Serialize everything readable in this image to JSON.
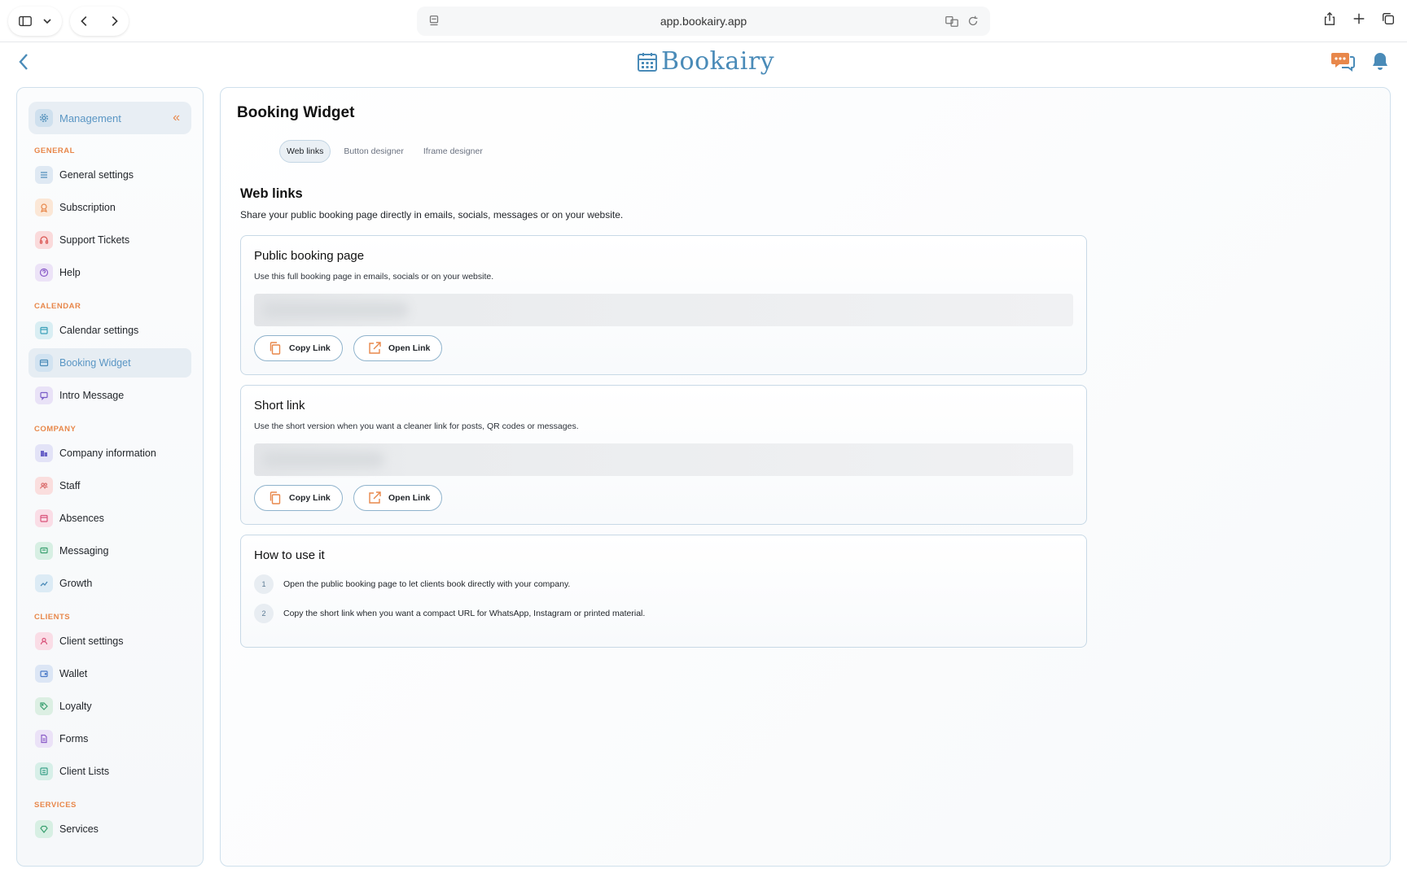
{
  "browser": {
    "url": "app.bookairy.app"
  },
  "app": {
    "logo_text": "Bookairy",
    "brand_color": "#4a8bb8",
    "accent_color": "#e8874a"
  },
  "sidebar": {
    "header_label": "Management",
    "sections": [
      {
        "label": "GENERAL",
        "items": [
          "General settings",
          "Subscription",
          "Support Tickets",
          "Help"
        ]
      },
      {
        "label": "CALENDAR",
        "items": [
          "Calendar settings",
          "Booking Widget",
          "Intro Message"
        ]
      },
      {
        "label": "COMPANY",
        "items": [
          "Company information",
          "Staff",
          "Absences",
          "Messaging",
          "Growth"
        ]
      },
      {
        "label": "CLIENTS",
        "items": [
          "Client settings",
          "Wallet",
          "Loyalty",
          "Forms",
          "Client Lists"
        ]
      },
      {
        "label": "SERVICES",
        "items": [
          "Services"
        ]
      }
    ],
    "active_item": "Booking Widget"
  },
  "main": {
    "title": "Booking Widget",
    "tabs": [
      "Web links",
      "Button designer",
      "Iframe designer"
    ],
    "active_tab": "Web links",
    "section_title": "Web links",
    "section_subtitle": "Share your public booking page directly in emails, socials, messages or on your website.",
    "cards": [
      {
        "title": "Public booking page",
        "description": "Use this full booking page in emails, socials or on your website.",
        "copy_label": "Copy Link",
        "open_label": "Open Link"
      },
      {
        "title": "Short link",
        "description": "Use the short version when you want a cleaner link for posts, QR codes or messages.",
        "copy_label": "Copy Link",
        "open_label": "Open Link"
      }
    ],
    "how_to": {
      "title": "How to use it",
      "steps": [
        {
          "num": "1",
          "text": "Open the public booking page to let clients book directly with your company."
        },
        {
          "num": "2",
          "text": "Copy the short link when you want a compact URL for WhatsApp, Instagram or printed material."
        }
      ]
    }
  }
}
